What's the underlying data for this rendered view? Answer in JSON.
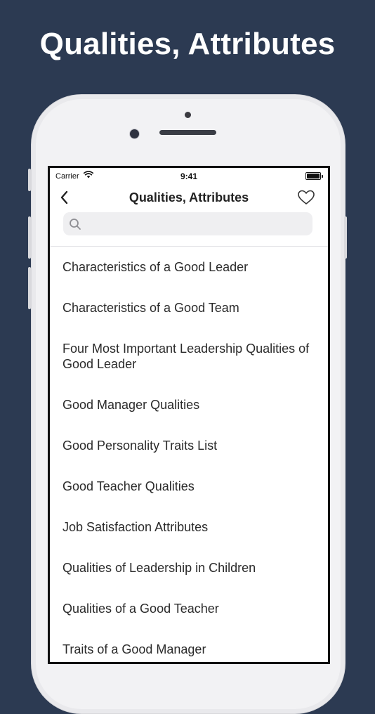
{
  "headline": "Qualities, Attributes",
  "status_bar": {
    "carrier": "Carrier",
    "time": "9:41"
  },
  "nav": {
    "title": "Qualities, Attributes",
    "back_icon": "chevron-left-icon",
    "favorite_icon": "heart-outline-icon"
  },
  "search": {
    "placeholder": "",
    "icon": "magnifier-icon"
  },
  "items": [
    {
      "label": "Characteristics of a Good Leader"
    },
    {
      "label": "Characteristics of a Good Team"
    },
    {
      "label": "Four Most Important Leadership Qualities of Good Leader"
    },
    {
      "label": "Good Manager Qualities"
    },
    {
      "label": "Good Personality Traits List"
    },
    {
      "label": "Good Teacher Qualities"
    },
    {
      "label": "Job Satisfaction Attributes"
    },
    {
      "label": "Qualities of Leadership in Children"
    },
    {
      "label": "Qualities of a Good Teacher"
    },
    {
      "label": "Traits of a Good Manager"
    }
  ],
  "colors": {
    "background": "#2c3a52",
    "headline_text": "#ffffff",
    "list_text": "#2a2a2a"
  }
}
